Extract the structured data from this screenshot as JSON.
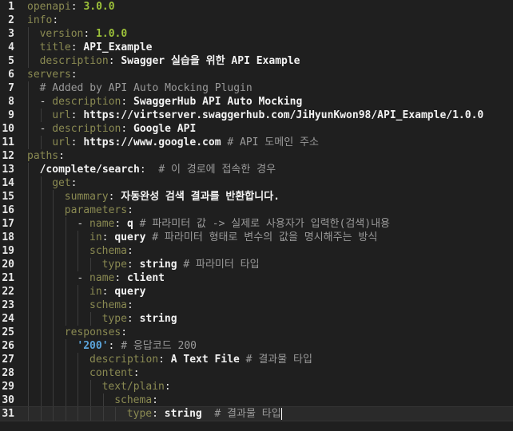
{
  "editor": {
    "lines": [
      {
        "n": "1",
        "indent": 0,
        "parts": [
          [
            "k",
            "openapi"
          ],
          [
            "p",
            ": "
          ],
          [
            "num",
            "3.0.0"
          ]
        ]
      },
      {
        "n": "2",
        "indent": 0,
        "parts": [
          [
            "k",
            "info"
          ],
          [
            "p",
            ":"
          ]
        ]
      },
      {
        "n": "3",
        "indent": 2,
        "parts": [
          [
            "k",
            "version"
          ],
          [
            "p",
            ": "
          ],
          [
            "num",
            "1.0.0"
          ]
        ]
      },
      {
        "n": "4",
        "indent": 2,
        "parts": [
          [
            "k",
            "title"
          ],
          [
            "p",
            ": "
          ],
          [
            "v",
            "API_Example"
          ]
        ]
      },
      {
        "n": "5",
        "indent": 2,
        "parts": [
          [
            "k",
            "description"
          ],
          [
            "p",
            ": "
          ],
          [
            "v",
            "Swagger 실습을 위한 API Example"
          ]
        ]
      },
      {
        "n": "6",
        "indent": 0,
        "parts": [
          [
            "k",
            "servers"
          ],
          [
            "p",
            ":"
          ]
        ]
      },
      {
        "n": "7",
        "indent": 2,
        "parts": [
          [
            "cm",
            "# Added by API Auto Mocking Plugin"
          ]
        ]
      },
      {
        "n": "8",
        "indent": 2,
        "parts": [
          [
            "dash",
            "- "
          ],
          [
            "k",
            "description"
          ],
          [
            "p",
            ": "
          ],
          [
            "v",
            "SwaggerHub API Auto Mocking"
          ]
        ]
      },
      {
        "n": "9",
        "indent": 4,
        "parts": [
          [
            "k",
            "url"
          ],
          [
            "p",
            ": "
          ],
          [
            "v",
            "https://virtserver.swaggerhub.com/JiHyunKwon98/API_Example/1.0.0"
          ]
        ]
      },
      {
        "n": "10",
        "indent": 2,
        "parts": [
          [
            "dash",
            "- "
          ],
          [
            "k",
            "description"
          ],
          [
            "p",
            ": "
          ],
          [
            "v",
            "Google API"
          ]
        ]
      },
      {
        "n": "11",
        "indent": 4,
        "parts": [
          [
            "k",
            "url"
          ],
          [
            "p",
            ": "
          ],
          [
            "v",
            "https://www.google.com"
          ],
          [
            "p",
            " "
          ],
          [
            "cm",
            "# API 도메인 주소"
          ]
        ]
      },
      {
        "n": "12",
        "indent": 0,
        "parts": [
          [
            "k",
            "paths"
          ],
          [
            "p",
            ":"
          ]
        ]
      },
      {
        "n": "13",
        "indent": 2,
        "parts": [
          [
            "v",
            "/complete/search"
          ],
          [
            "p",
            ":  "
          ],
          [
            "cm",
            "# 이 경로에 접속한 경우"
          ]
        ]
      },
      {
        "n": "14",
        "indent": 4,
        "parts": [
          [
            "k",
            "get"
          ],
          [
            "p",
            ":"
          ]
        ]
      },
      {
        "n": "15",
        "indent": 6,
        "parts": [
          [
            "k",
            "summary"
          ],
          [
            "p",
            ": "
          ],
          [
            "v",
            "자동완성 검색 결과를 반환합니다."
          ]
        ]
      },
      {
        "n": "16",
        "indent": 6,
        "parts": [
          [
            "k",
            "parameters"
          ],
          [
            "p",
            ":"
          ]
        ]
      },
      {
        "n": "17",
        "indent": 8,
        "parts": [
          [
            "dash",
            "- "
          ],
          [
            "k",
            "name"
          ],
          [
            "p",
            ": "
          ],
          [
            "v",
            "q"
          ],
          [
            "p",
            " "
          ],
          [
            "cm",
            "# 파라미터 값 -> 실제로 사용자가 입력한(검색)내용"
          ]
        ]
      },
      {
        "n": "18",
        "indent": 10,
        "parts": [
          [
            "k",
            "in"
          ],
          [
            "p",
            ": "
          ],
          [
            "v",
            "query"
          ],
          [
            "p",
            " "
          ],
          [
            "cm",
            "# 파라미터 형태로 변수의 값을 명시해주는 방식"
          ]
        ]
      },
      {
        "n": "19",
        "indent": 10,
        "parts": [
          [
            "k",
            "schema"
          ],
          [
            "p",
            ":"
          ]
        ]
      },
      {
        "n": "20",
        "indent": 12,
        "parts": [
          [
            "k",
            "type"
          ],
          [
            "p",
            ": "
          ],
          [
            "v",
            "string"
          ],
          [
            "p",
            " "
          ],
          [
            "cm",
            "# 파라미터 타입"
          ]
        ]
      },
      {
        "n": "21",
        "indent": 8,
        "parts": [
          [
            "dash",
            "- "
          ],
          [
            "k",
            "name"
          ],
          [
            "p",
            ": "
          ],
          [
            "v",
            "client"
          ]
        ]
      },
      {
        "n": "22",
        "indent": 10,
        "parts": [
          [
            "k",
            "in"
          ],
          [
            "p",
            ": "
          ],
          [
            "v",
            "query"
          ]
        ]
      },
      {
        "n": "23",
        "indent": 10,
        "parts": [
          [
            "k",
            "schema"
          ],
          [
            "p",
            ":"
          ]
        ]
      },
      {
        "n": "24",
        "indent": 12,
        "parts": [
          [
            "k",
            "type"
          ],
          [
            "p",
            ": "
          ],
          [
            "v",
            "string"
          ]
        ]
      },
      {
        "n": "25",
        "indent": 6,
        "parts": [
          [
            "k",
            "responses"
          ],
          [
            "p",
            ":"
          ]
        ]
      },
      {
        "n": "26",
        "indent": 8,
        "parts": [
          [
            "str",
            "'200'"
          ],
          [
            "p",
            ": "
          ],
          [
            "cm",
            "# 응답코드 200"
          ]
        ]
      },
      {
        "n": "27",
        "indent": 10,
        "parts": [
          [
            "k",
            "description"
          ],
          [
            "p",
            ": "
          ],
          [
            "v",
            "A Text File"
          ],
          [
            "p",
            " "
          ],
          [
            "cm",
            "# 결과물 타입"
          ]
        ]
      },
      {
        "n": "28",
        "indent": 10,
        "parts": [
          [
            "k",
            "content"
          ],
          [
            "p",
            ":"
          ]
        ]
      },
      {
        "n": "29",
        "indent": 12,
        "parts": [
          [
            "k",
            "text/plain"
          ],
          [
            "p",
            ":"
          ]
        ]
      },
      {
        "n": "30",
        "indent": 14,
        "parts": [
          [
            "k",
            "schema"
          ],
          [
            "p",
            ":"
          ]
        ]
      },
      {
        "n": "31",
        "indent": 16,
        "parts": [
          [
            "k",
            "type"
          ],
          [
            "p",
            ": "
          ],
          [
            "v",
            "string"
          ],
          [
            "p",
            "  "
          ],
          [
            "cm",
            "# 결과물 타입"
          ]
        ],
        "current": true
      }
    ]
  },
  "colors": {
    "background": "#1f1f1f",
    "key": "#8a8a52",
    "value": "#f2f2f2",
    "number": "#9dc23a",
    "quoted": "#5ba3d9",
    "comment": "#9a9a9a"
  }
}
